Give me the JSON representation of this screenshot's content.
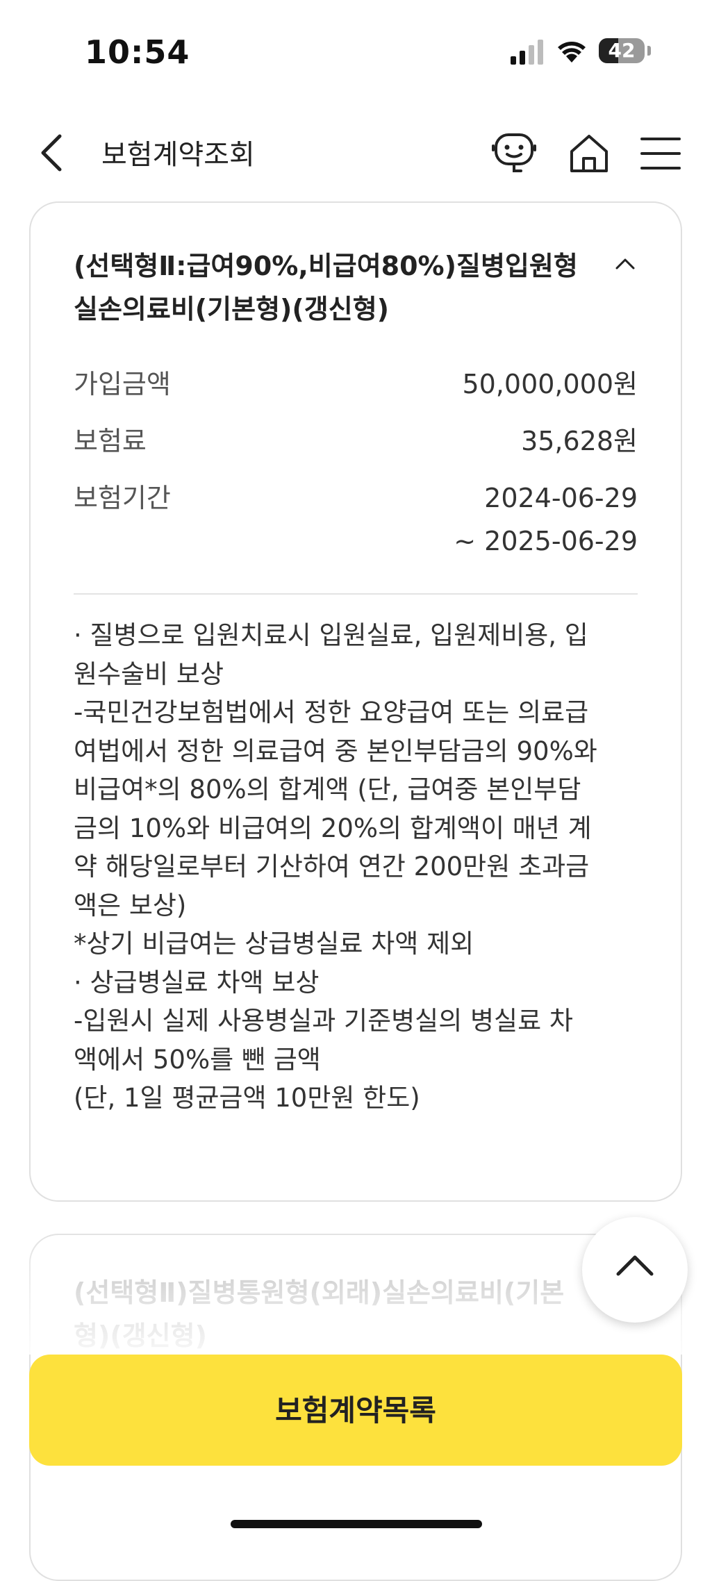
{
  "status_bar": {
    "time": "10:54",
    "battery_level": "42",
    "icons": [
      "signal-icon",
      "wifi-icon",
      "battery-icon"
    ]
  },
  "header": {
    "title": "보험계약조회",
    "icons": [
      "back-icon",
      "chatbot-icon",
      "home-icon",
      "menu-icon"
    ]
  },
  "coverage_1": {
    "title_line1": "(선택형Ⅱ:급여90%,비급여80%)질병입원형",
    "title_line2": "실손의료비(기본형)(갱신형)",
    "rows": [
      {
        "label": "가입금액",
        "value": "50,000,000원"
      },
      {
        "label": "보험료",
        "value": "35,628원"
      },
      {
        "label": "보험기간",
        "value_line1": "2024-06-29",
        "value_line2": "~ 2025-06-29"
      }
    ],
    "description": [
      "· 질병으로 입원치료시 입원실료, 입원제비용, 입",
      "원수술비 보상",
      "-국민건강보험법에서 정한 요양급여 또는 의료급",
      "여법에서 정한 의료급여 중 본인부담금의 90%와",
      "비급여*의 80%의 합계액 (단, 급여중 본인부담",
      "금의 10%와 비급여의 20%의 합계액이 매년 계",
      "약 해당일로부터 기산하여 연간 200만원 초과금",
      "액은 보상)",
      "*상기 비급여는 상급병실료 차액 제외",
      "· 상급병실료 차액 보상",
      "-입원시 실제 사용병실과 기준병실의 병실료 차",
      "액에서 50%를 뺀 금액",
      "(단, 1일 평균금액 10만원 한도)"
    ]
  },
  "coverage_2": {
    "title_line1": "(선택형Ⅱ)질병통원형(외래)실손의료비(기본",
    "title_line2": "형)(갱신형)"
  },
  "bottom_button": {
    "label": "보험계약목록"
  },
  "colors": {
    "accent_yellow": "#fde13d",
    "card_border": "#e0e0e0",
    "text_primary": "#222222",
    "text_secondary": "#555555"
  }
}
